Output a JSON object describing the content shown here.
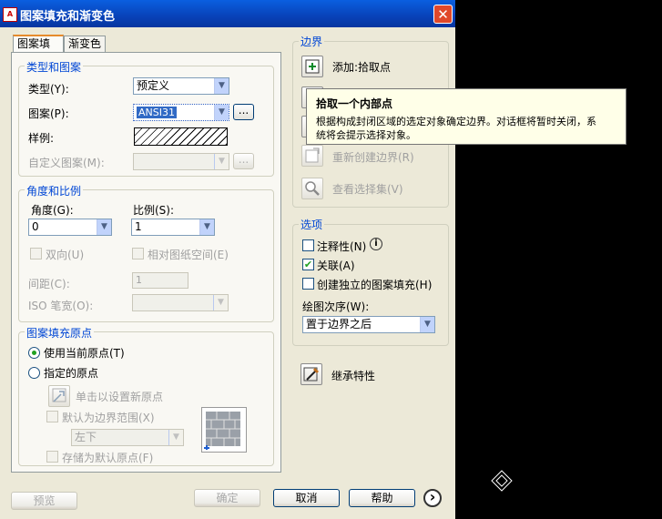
{
  "window": {
    "title": "图案填充和渐变色",
    "app_icon_text": "A"
  },
  "tabs": [
    {
      "label": "图案填充"
    },
    {
      "label": "渐变色"
    }
  ],
  "type_pattern": {
    "title": "类型和图案",
    "type_label": "类型(Y):",
    "type_value": "预定义",
    "pattern_label": "图案(P):",
    "pattern_value": "ANSI31",
    "browse_label": "...",
    "swatch_label": "样例:",
    "custom_label": "自定义图案(M):",
    "custom_value": ""
  },
  "angle_scale": {
    "title": "角度和比例",
    "angle_label": "角度(G):",
    "angle_value": "0",
    "scale_label": "比例(S):",
    "scale_value": "1",
    "double_label": "双向(U)",
    "relative_label": "相对图纸空间(E)",
    "spacing_label": "间距(C):",
    "spacing_value": "1",
    "iso_label": "ISO 笔宽(O):"
  },
  "origin": {
    "title": "图案填充原点",
    "use_current_label": "使用当前原点(T)",
    "specified_label": "指定的原点",
    "click_set_label": "单击以设置新原点",
    "default_extent_label": "默认为边界范围(X)",
    "extent_value": "左下",
    "store_default_label": "存储为默认原点(F)"
  },
  "boundary": {
    "title": "边界",
    "add_pick_label": "添加:拾取点",
    "recreate_label": "重新创建边界(R)",
    "view_selection_label": "查看选择集(V)"
  },
  "tooltip": {
    "title": "拾取一个内部点",
    "line1": "根据构成封闭区域的选定对象确定边界。对话框将暂时关闭，系",
    "line2": "统将会提示选择对象。"
  },
  "options": {
    "title": "选项",
    "annotative_label": "注释性(N)",
    "associative_label": "关联(A)",
    "separate_label": "创建独立的图案填充(H)",
    "draw_order_label": "绘图次序(W):",
    "draw_order_value": "置于边界之后"
  },
  "inherit_label": "继承特性",
  "footer": {
    "preview_label": "预览",
    "ok_label": "确定",
    "cancel_label": "取消",
    "help_label": "帮助",
    "more_label": "›"
  }
}
